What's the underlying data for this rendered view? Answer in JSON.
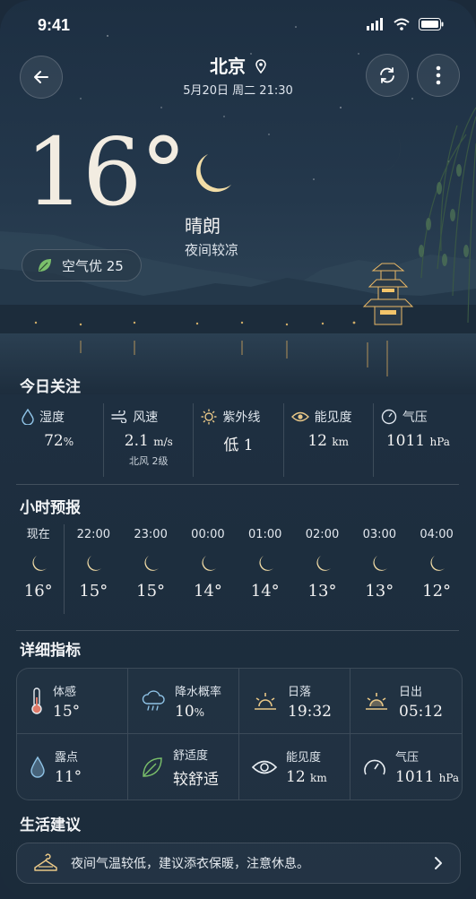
{
  "status_bar": {
    "time": "9:41"
  },
  "header": {
    "city": "北京",
    "datetime": "5月20日 周二 21:30"
  },
  "current": {
    "temperature": "16°",
    "condition": "晴朗",
    "condition_note": "夜间较凉",
    "aqi_label": "空气优 25"
  },
  "today": {
    "title": "今日关注",
    "items": [
      {
        "label": "湿度",
        "value": "72",
        "unit": "%",
        "note": "",
        "icon": "droplet-icon"
      },
      {
        "label": "风速",
        "value": "2.1",
        "unit": "m/s",
        "note": "北风 2级",
        "icon": "wind-icon"
      },
      {
        "label": "紫外线",
        "value": "低 1",
        "unit": "",
        "note": "",
        "icon": "sun-icon"
      },
      {
        "label": "能见度",
        "value": "12",
        "unit": "km",
        "note": "",
        "icon": "eye-icon"
      },
      {
        "label": "气压",
        "value": "1011",
        "unit": "hPa",
        "note": "",
        "icon": "gauge-icon"
      }
    ]
  },
  "hourly": {
    "title": "小时预报",
    "items": [
      {
        "time": "现在",
        "temp": "16°"
      },
      {
        "time": "22:00",
        "temp": "15°"
      },
      {
        "time": "23:00",
        "temp": "15°"
      },
      {
        "time": "00:00",
        "temp": "14°"
      },
      {
        "time": "01:00",
        "temp": "14°"
      },
      {
        "time": "02:00",
        "temp": "13°"
      },
      {
        "time": "03:00",
        "temp": "13°"
      },
      {
        "time": "04:00",
        "temp": "12°"
      }
    ]
  },
  "details": {
    "title": "详细指标",
    "items": [
      {
        "label": "体感",
        "value": "15°",
        "unit": "",
        "icon": "thermometer-icon"
      },
      {
        "label": "降水概率",
        "value": "10",
        "unit": "%",
        "icon": "rain-cloud-icon"
      },
      {
        "label": "日落",
        "value": "19:32",
        "unit": "",
        "icon": "sunset-icon"
      },
      {
        "label": "日出",
        "value": "05:12",
        "unit": "",
        "icon": "sunrise-icon"
      },
      {
        "label": "露点",
        "value": "11°",
        "unit": "",
        "icon": "dewdrop-icon"
      },
      {
        "label": "舒适度",
        "value": "较舒适",
        "unit": "",
        "icon": "leaf-icon"
      },
      {
        "label": "能见度",
        "value": "12",
        "unit": "km",
        "icon": "eye-icon"
      },
      {
        "label": "气压",
        "value": "1011",
        "unit": "hPa",
        "icon": "gauge-icon"
      }
    ]
  },
  "advice": {
    "title": "生活建议",
    "text": "夜间气温较低，建议添衣保暖，注意休息。"
  },
  "colors": {
    "accent": "#e8c787",
    "background": "#1c2c3e",
    "leaf": "#7bc06b"
  }
}
